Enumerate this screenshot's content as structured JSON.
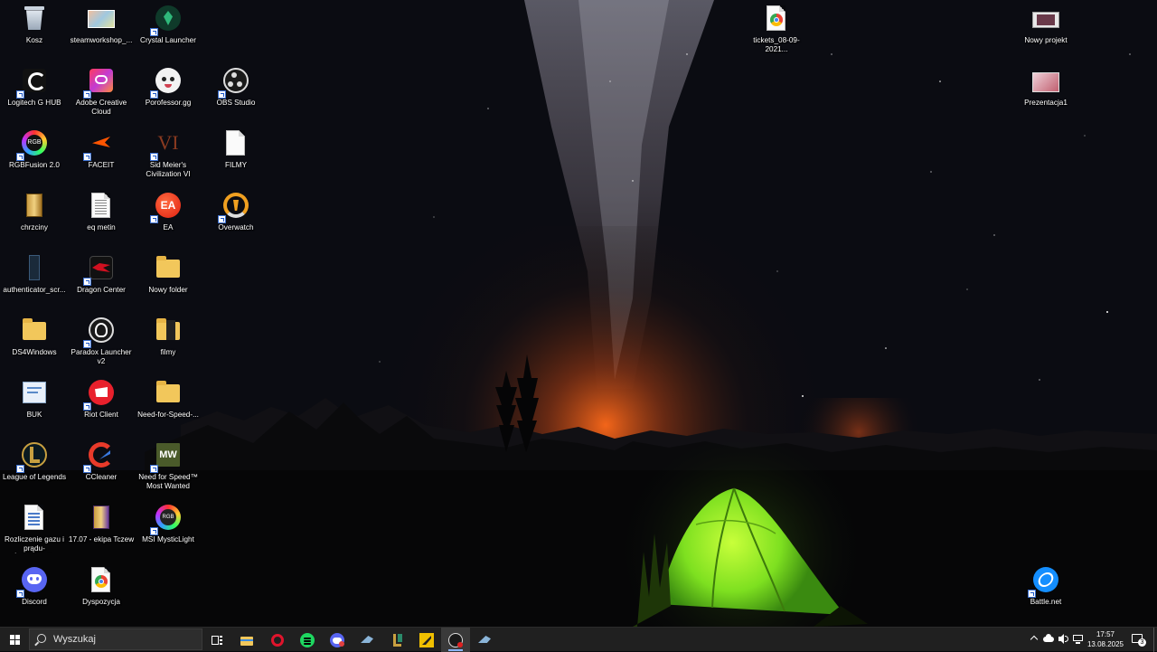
{
  "desktop": {
    "icons": [
      {
        "label": "Kosz",
        "icon": "recycle-bin-icon",
        "shortcut": false
      },
      {
        "label": "Logitech G HUB",
        "icon": "logitech-icon",
        "shortcut": true
      },
      {
        "label": "RGBFusion 2.0",
        "icon": "rgb-fusion-icon",
        "shortcut": true
      },
      {
        "label": "chrzciny",
        "icon": "archive-icon",
        "shortcut": false
      },
      {
        "label": "authenticator_scr...",
        "icon": "image-file-icon",
        "shortcut": false
      },
      {
        "label": "DS4Windows",
        "icon": "folder-icon",
        "shortcut": false
      },
      {
        "label": "BUK",
        "icon": "text-document-icon",
        "shortcut": false
      },
      {
        "label": "League of Legends",
        "icon": "league-of-legends-icon",
        "shortcut": true
      },
      {
        "label": "Rozliczenie gazu i prądu- Świętojańska",
        "icon": "document-icon",
        "shortcut": false
      },
      {
        "label": "Discord",
        "icon": "discord-icon",
        "shortcut": true
      },
      {
        "label": "steamworkshop_...",
        "icon": "image-file-icon",
        "shortcut": false
      },
      {
        "label": "Adobe Creative Cloud",
        "icon": "adobe-cc-icon",
        "shortcut": true
      },
      {
        "label": "FACEIT",
        "icon": "faceit-icon",
        "shortcut": true
      },
      {
        "label": "eq metin",
        "icon": "text-file-icon",
        "shortcut": false
      },
      {
        "label": "Dragon Center",
        "icon": "dragon-center-icon",
        "shortcut": true
      },
      {
        "label": "Paradox Launcher v2",
        "icon": "paradox-icon",
        "shortcut": true
      },
      {
        "label": "Riot Client",
        "icon": "riot-client-icon",
        "shortcut": true
      },
      {
        "label": "CCleaner",
        "icon": "ccleaner-icon",
        "shortcut": true
      },
      {
        "label": "17.07 - ekipa Tczew",
        "icon": "archive-icon",
        "shortcut": false
      },
      {
        "label": "Dyspozycja",
        "icon": "chrome-document-icon",
        "shortcut": false
      },
      {
        "label": "Crystal Launcher",
        "icon": "crystal-launcher-icon",
        "shortcut": true
      },
      {
        "label": "Porofessor.gg",
        "icon": "porofessor-icon",
        "shortcut": true
      },
      {
        "label": "Sid Meier's Civilization VI",
        "icon": "civilization-icon",
        "shortcut": true
      },
      {
        "label": "EA",
        "icon": "ea-icon",
        "shortcut": true
      },
      {
        "label": "Nowy folder",
        "icon": "folder-icon",
        "shortcut": false
      },
      {
        "label": "filmy",
        "icon": "folder-icon",
        "shortcut": false
      },
      {
        "label": "Need-for-Speed-...",
        "icon": "folder-icon",
        "shortcut": false
      },
      {
        "label": "Need for Speed™ Most Wanted",
        "icon": "nfs-icon",
        "shortcut": true
      },
      {
        "label": "MSI MysticLight",
        "icon": "mystic-light-icon",
        "shortcut": true
      },
      {
        "label": "OBS Studio",
        "icon": "obs-icon",
        "shortcut": true
      },
      {
        "label": "FILMY",
        "icon": "blank-file-icon",
        "shortcut": false
      },
      {
        "label": "Overwatch",
        "icon": "overwatch-icon",
        "shortcut": true
      },
      {
        "label": "tickets_08-09-2021...",
        "icon": "chrome-document-icon",
        "shortcut": false
      },
      {
        "label": "Nowy projekt",
        "icon": "video-project-icon",
        "shortcut": false
      },
      {
        "label": "Prezentacja1",
        "icon": "presentation-icon",
        "shortcut": false
      },
      {
        "label": "Battle.net",
        "icon": "battlenet-icon",
        "shortcut": true
      }
    ]
  },
  "taskbar": {
    "search_placeholder": "Wyszukaj",
    "pinned": [
      {
        "name": "task-view-icon",
        "active": false
      },
      {
        "name": "file-explorer-icon",
        "active": false
      },
      {
        "name": "opera-icon",
        "active": false
      },
      {
        "name": "spotify-icon",
        "active": false
      },
      {
        "name": "discord-icon",
        "active": false
      },
      {
        "name": "steam-icon",
        "active": false
      },
      {
        "name": "league-of-legends-icon",
        "active": false
      },
      {
        "name": "faceit-app-icon",
        "active": false
      },
      {
        "name": "obs-icon",
        "active": true
      },
      {
        "name": "steam-icon-2",
        "active": false
      }
    ],
    "tray": {
      "time": "17:57",
      "date": "13.08.2025",
      "notifications": "3"
    }
  },
  "colors": {
    "taskbar_bg": "#202020",
    "tent_green": "#7ee020",
    "horizon_glow": "#ff6a1a"
  }
}
